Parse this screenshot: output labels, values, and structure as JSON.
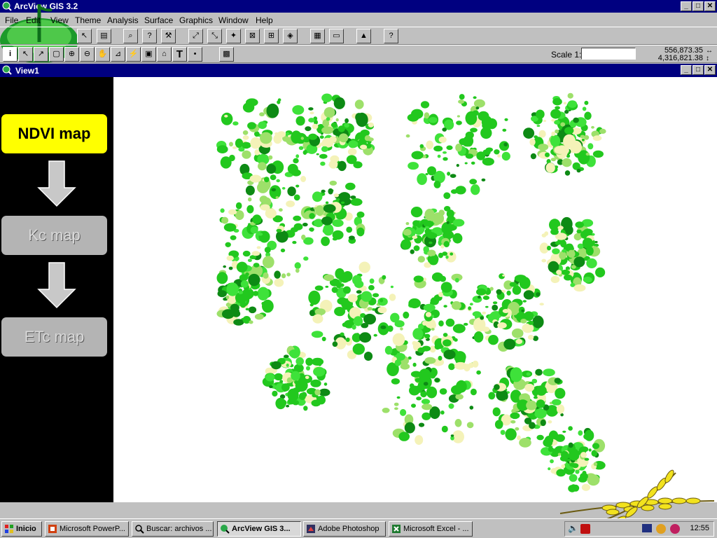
{
  "app": {
    "title": "ArcView GIS 3.2"
  },
  "menu": [
    "File",
    "Edit",
    "View",
    "Theme",
    "Analysis",
    "Surface",
    "Graphics",
    "Window",
    "Help"
  ],
  "toolbar2": {
    "scale_label": "Scale 1:",
    "scale_value": "",
    "coord_x": "556,873.35",
    "coord_y": "4,316,821.38"
  },
  "view": {
    "title": "View1"
  },
  "flow": {
    "step1": "NDVI map",
    "step2": "Kc map",
    "step3": "ETc map"
  },
  "taskbar": {
    "start": "Inicio",
    "items": [
      "Microsoft PowerP...",
      "Buscar: archivos ...",
      "ArcView GIS 3...",
      "Adobe Photoshop",
      "Microsoft Excel - ..."
    ],
    "clock": "12:55"
  },
  "colors": {
    "title_bar": "#000080",
    "ndvi_box": "#ffff00",
    "vegetation": "#22c81e",
    "vegetation_dark": "#0d8a14",
    "crop_pale": "#f4f2b8"
  }
}
